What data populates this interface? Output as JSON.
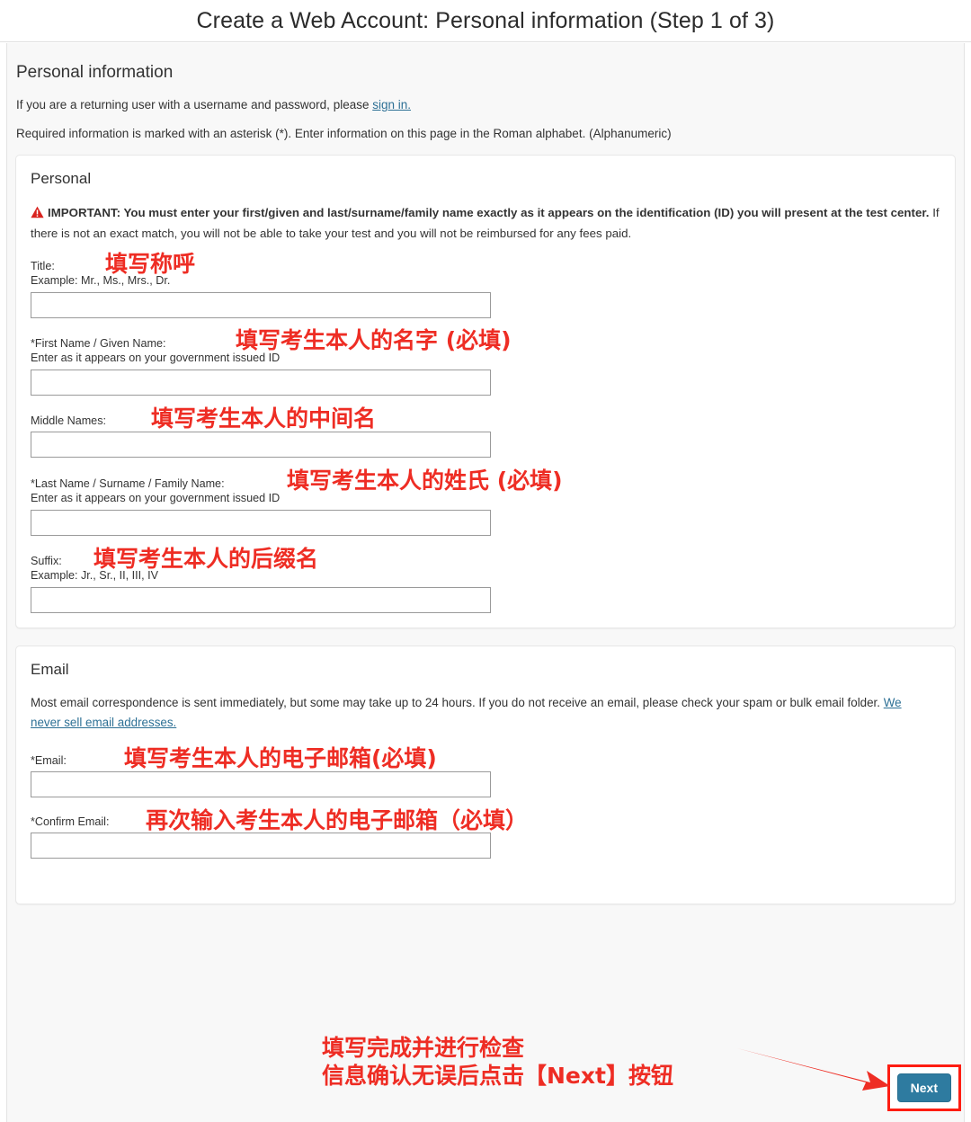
{
  "header": {
    "title": "Create a Web Account: Personal information (Step 1 of 3)"
  },
  "page": {
    "section_heading": "Personal information",
    "returning_user_text": "If you are a returning user with a username and password, please ",
    "sign_in_link": "sign in.",
    "required_note": "Required information is marked with an asterisk (*). Enter information on this page in the Roman alphabet. (Alphanumeric)"
  },
  "personal_panel": {
    "title": "Personal",
    "warning_icon": "warning-triangle-icon",
    "warning_bold": "IMPORTANT: You must enter your first/given and last/surname/family name exactly as it appears on the identification (ID) you will present at the test center.",
    "warning_rest": " If there is not an exact match, you will not be able to take your test and you will not be reimbursed for any fees paid.",
    "fields": [
      {
        "label": "Title:",
        "hint": "Example: Mr., Ms., Mrs., Dr.",
        "value": "",
        "annotation": "填写称呼"
      },
      {
        "label": "*First Name / Given Name:",
        "hint": "Enter as it appears on your government issued ID",
        "value": "",
        "annotation": "填写考生本人的名字 (必填)"
      },
      {
        "label": "Middle Names:",
        "hint": "",
        "value": "",
        "annotation": "填写考生本人的中间名"
      },
      {
        "label": "*Last Name / Surname / Family Name:",
        "hint": "Enter as it appears on your government issued ID",
        "value": "",
        "annotation": "填写考生本人的姓氏 (必填)"
      },
      {
        "label": "Suffix:",
        "hint": "Example: Jr., Sr., II, III, IV",
        "value": "",
        "annotation": "填写考生本人的后缀名"
      }
    ]
  },
  "email_panel": {
    "title": "Email",
    "description": "Most email correspondence is sent immediately, but some may take up to 24 hours. If you do not receive an email, please check your spam or bulk email folder. ",
    "privacy_link": "We never sell email addresses.",
    "fields": [
      {
        "label": "*Email:",
        "hint": "",
        "value": "",
        "annotation": "填写考生本人的电子邮箱(必填)"
      },
      {
        "label": "*Confirm Email:",
        "hint": "",
        "value": "",
        "annotation": "再次输入考生本人的电子邮箱（必填）"
      }
    ]
  },
  "footer": {
    "next_label": "Next",
    "annotation_line1": "填写完成并进行检查",
    "annotation_line2": "信息确认无误后点击【Next】按钮",
    "arrow_icon": "arrow-right-icon"
  },
  "colors": {
    "annotation_red": "#ee2d24",
    "highlight_box_red": "#fe1d12",
    "next_button_blue": "#2e7ba0",
    "link_blue": "#2d7095",
    "page_background": "#f8f8f8",
    "panel_background": "#ffffff"
  }
}
